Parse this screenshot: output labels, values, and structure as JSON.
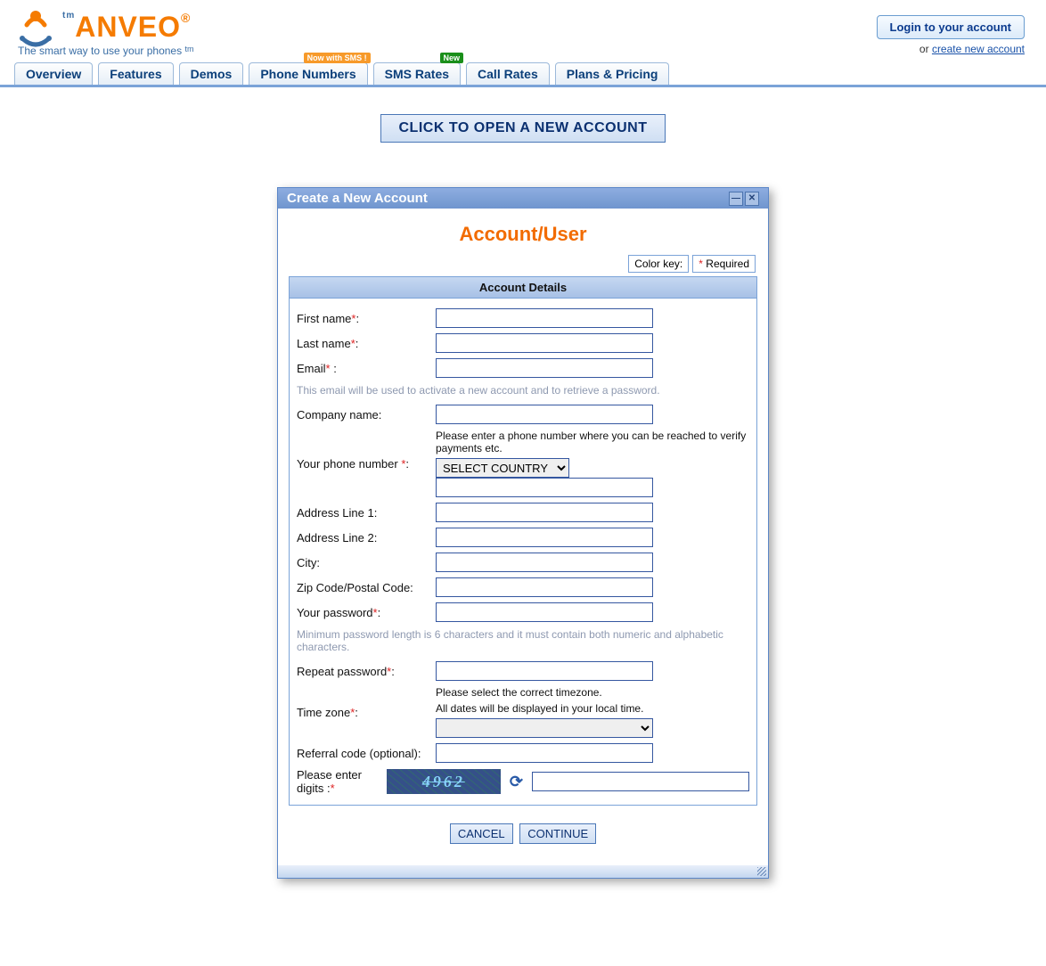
{
  "brand": {
    "name": "ANVEO",
    "tagline": "The smart way to use your phones",
    "tm": "tm"
  },
  "login": {
    "button": "Login to your account",
    "or": "or",
    "create_link": "create new account"
  },
  "tabs": [
    {
      "label": "Overview",
      "badge": null
    },
    {
      "label": "Features",
      "badge": null
    },
    {
      "label": "Demos",
      "badge": null
    },
    {
      "label": "Phone Numbers",
      "badge": {
        "text": "Now with SMS !",
        "color": "orange"
      }
    },
    {
      "label": "SMS Rates",
      "badge": {
        "text": "New",
        "color": "green"
      }
    },
    {
      "label": "Call Rates",
      "badge": null
    },
    {
      "label": "Plans & Pricing",
      "badge": null
    }
  ],
  "open_account_button": "CLICK TO OPEN A NEW ACCOUNT",
  "modal": {
    "title": "Create a New Account",
    "section": "Account/User",
    "color_key": "Color key:",
    "required": "Required",
    "table_head": "Account Details",
    "fields": {
      "first_name": "First name",
      "last_name": "Last name",
      "email": "Email",
      "email_hint": "This email will be used to activate a new account and to retrieve a password.",
      "company": "Company name:",
      "phone_label": "Your phone number ",
      "phone_note": "Please enter a phone number where you can be reached to verify payments etc.",
      "country_option": "SELECT COUNTRY",
      "addr1": "Address Line 1:",
      "addr2": "Address Line 2:",
      "city": "City:",
      "zip": "Zip Code/Postal Code:",
      "password": "Your password",
      "password_hint": "Minimum password length is 6 characters and it must contain both numeric and alphabetic characters.",
      "repeat_password": "Repeat password",
      "tz_label": "Time zone",
      "tz_note1": "Please select the correct timezone.",
      "tz_note2": "All dates will be displayed in your local time.",
      "referral": "Referral code (optional):",
      "captcha_label": "Please enter digits :",
      "captcha_value": "4962"
    },
    "actions": {
      "cancel": "CANCEL",
      "continue": "CONTINUE"
    }
  }
}
